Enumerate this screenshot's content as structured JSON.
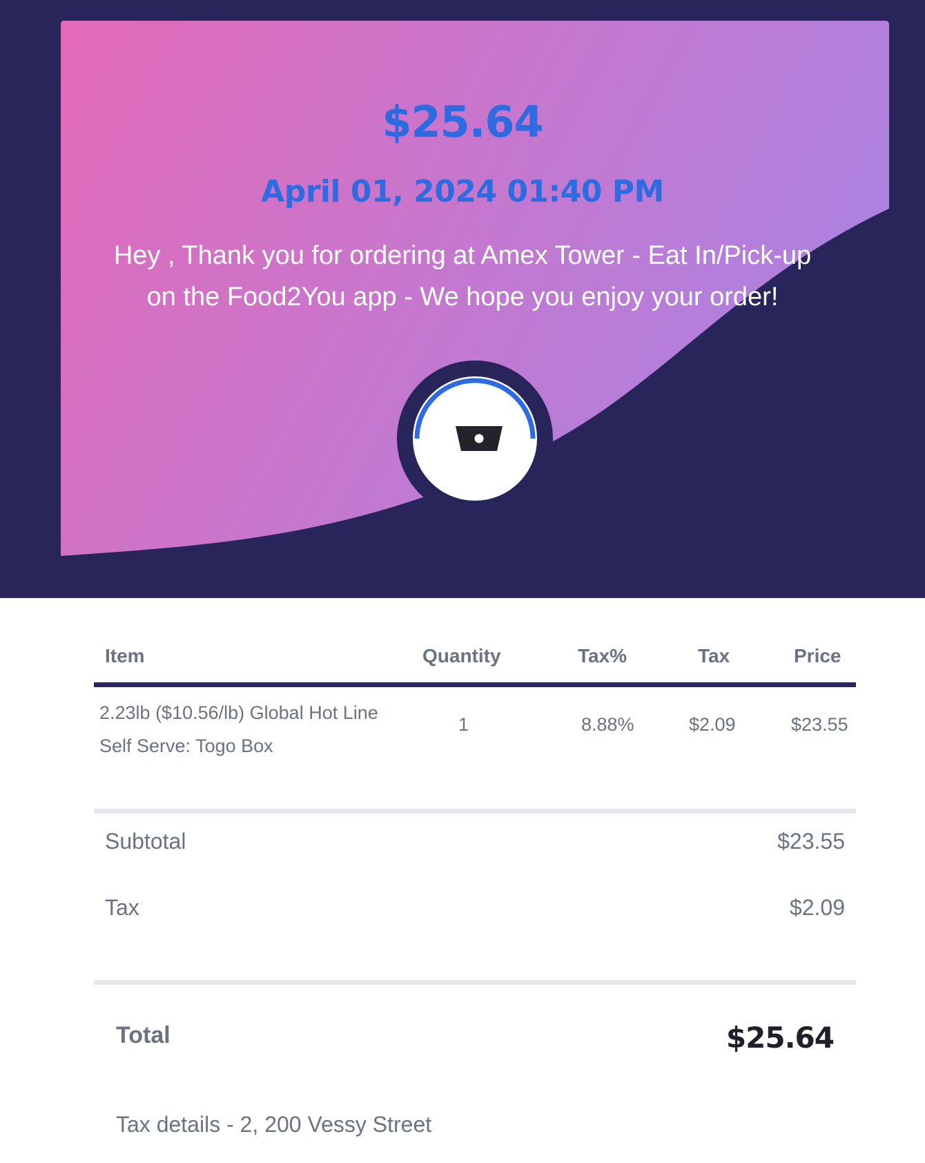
{
  "colors": {
    "header_bg": "#28255a",
    "gradient_start": "#e36ab8",
    "gradient_end": "#ad82e0",
    "accent_blue": "#2f6be0",
    "text_gray": "#6b7280",
    "total_dark": "#1f1f29"
  },
  "hero": {
    "amount": "$25.64",
    "date": "April 01, 2024 01:40 PM",
    "message": "Hey , Thank you for ordering at Amex Tower - Eat In/Pick-up on the Food2You app - We hope you enjoy your order!",
    "icon": "basket-icon"
  },
  "table": {
    "headers": {
      "item": "Item",
      "quantity": "Quantity",
      "tax_percent": "Tax%",
      "tax": "Tax",
      "price": "Price"
    },
    "rows": [
      {
        "item": "2.23lb ($10.56/lb) Global Hot Line Self Serve: Togo Box",
        "quantity": "1",
        "tax_percent": "8.88%",
        "tax": "$2.09",
        "price": "$23.55"
      }
    ]
  },
  "summary": {
    "subtotal_label": "Subtotal",
    "subtotal_value": "$23.55",
    "tax_label": "Tax",
    "tax_value": "$2.09"
  },
  "total": {
    "label": "Total",
    "value": "$25.64"
  },
  "footer": {
    "tax_details": "Tax details - 2, 200 Vessy Street"
  }
}
